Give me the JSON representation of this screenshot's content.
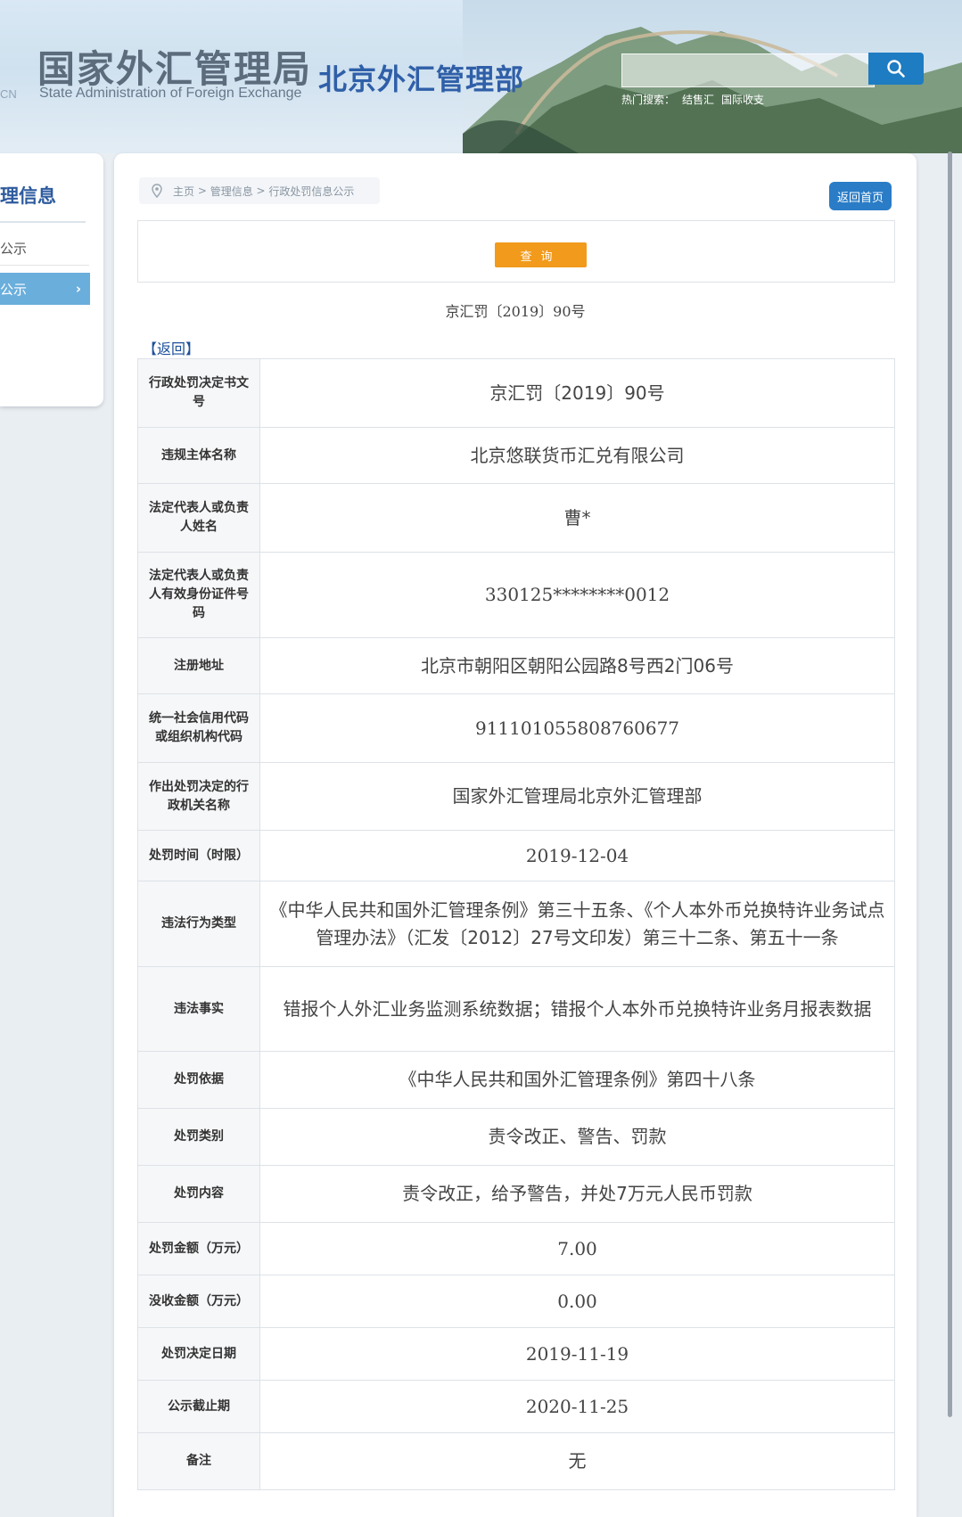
{
  "header": {
    "logo_prefix": "CN",
    "logo_cn": "国家外汇管理局",
    "logo_en": "State Administration of Foreign Exchange",
    "dept": "北京外汇管理部",
    "search_placeholder": "",
    "hot_label": "热门搜索：",
    "hot_items": [
      "结售汇",
      "国际收支"
    ]
  },
  "sidebar": {
    "title": "理信息",
    "items": [
      {
        "label": "公示"
      },
      {
        "label": "公示"
      }
    ]
  },
  "main": {
    "breadcrumb": [
      "主页",
      "管理信息",
      "行政处罚信息公示"
    ],
    "back_home": "返回首页",
    "query_button": "查询",
    "doc_number": "京汇罚〔2019〕90号",
    "back_link": "【返回】"
  },
  "rows": [
    {
      "label": "行政处罚决定书文号",
      "value": "京汇罚〔2019〕90号"
    },
    {
      "label": "违规主体名称",
      "value": "北京悠联货币汇兑有限公司"
    },
    {
      "label": "法定代表人或负责人姓名",
      "value": "曹*"
    },
    {
      "label": "法定代表人或负责人有效身份证件号码",
      "value": "330125********0012"
    },
    {
      "label": "注册地址",
      "value": "北京市朝阳区朝阳公园路8号西2门06号"
    },
    {
      "label": "统一社会信用代码或组织机构代码",
      "value": "911101055808760677"
    },
    {
      "label": "作出处罚决定的行政机关名称",
      "value": "国家外汇管理局北京外汇管理部"
    },
    {
      "label": "处罚时间（时限）",
      "value": "2019-12-04"
    },
    {
      "label": "违法行为类型",
      "value": "《中华人民共和国外汇管理条例》第三十五条、《个人本外币兑换特许业务试点管理办法》（汇发〔2012〕27号文印发）第三十二条、第五十一条"
    },
    {
      "label": "违法事实",
      "value": "错报个人外汇业务监测系统数据；错报个人本外币兑换特许业务月报表数据"
    },
    {
      "label": "处罚依据",
      "value": "《中华人民共和国外汇管理条例》第四十八条"
    },
    {
      "label": "处罚类别",
      "value": "责令改正、警告、罚款"
    },
    {
      "label": "处罚内容",
      "value": "责令改正，给予警告，并处7万元人民币罚款"
    },
    {
      "label": "处罚金额（万元）",
      "value": "7.00"
    },
    {
      "label": "没收金额（万元）",
      "value": "0.00"
    },
    {
      "label": "处罚决定日期",
      "value": "2019-11-19"
    },
    {
      "label": "公示截止期",
      "value": "2020-11-25"
    },
    {
      "label": "备注",
      "value": "无"
    }
  ],
  "colors": {
    "accent_blue": "#2a7cc6",
    "query_orange": "#f19a1b",
    "sidebar_active": "#6aaedc"
  }
}
